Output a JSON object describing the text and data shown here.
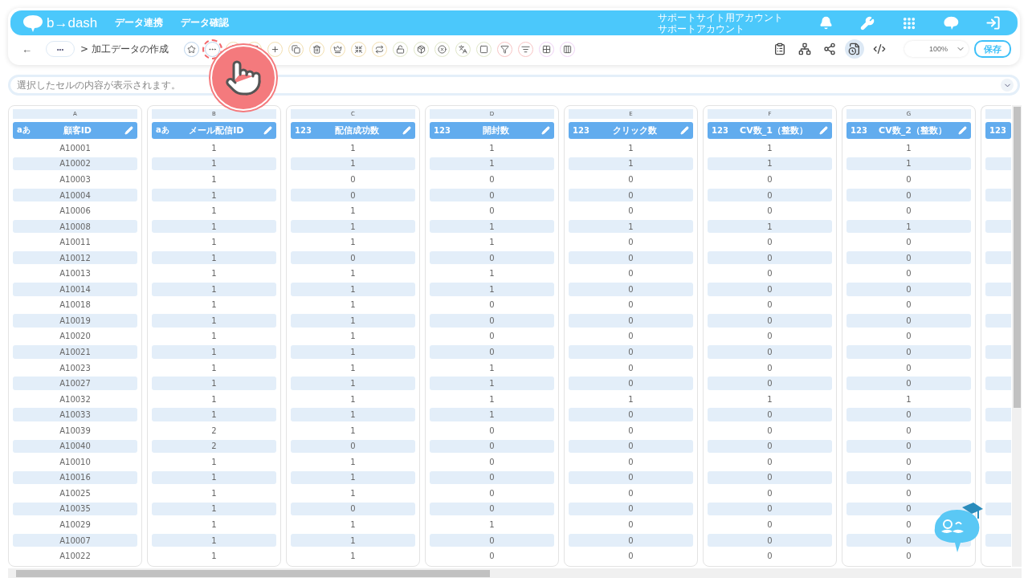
{
  "header": {
    "logo": "b→dash",
    "nav": [
      "データ連携",
      "データ確認"
    ],
    "account": {
      "line_1": "サポートサイト用アカウント",
      "line_2": "サポートアカウント"
    }
  },
  "toolbar": {
    "back": "←",
    "breadcrumb_more": "•••",
    "breadcrumb": "> 加工データの作成",
    "tools": [
      {
        "highlighted": false
      },
      {
        "highlighted": true
      },
      {
        "highlighted": false
      },
      {
        "highlighted": false
      },
      {
        "highlighted": false
      },
      {
        "highlighted": false
      },
      {
        "highlighted": false
      },
      {
        "highlighted": false
      },
      {
        "highlighted": false
      },
      {
        "highlighted": false
      },
      {
        "highlighted": false
      },
      {
        "highlighted": false
      },
      {
        "highlighted": false
      },
      {
        "highlighted": false
      },
      {
        "highlighted": false
      },
      {
        "highlighted": false
      },
      {
        "highlighted": false
      },
      {
        "highlighted": false
      },
      {
        "highlighted": false
      }
    ],
    "view_buttons": [
      {
        "selected": false
      },
      {
        "selected": false
      },
      {
        "selected": false
      },
      {
        "selected": true
      },
      {
        "selected": false
      }
    ],
    "zoom": "100%",
    "save": "保存"
  },
  "formula_bar": {
    "placeholder": "選択したセルの内容が表示されます。"
  },
  "table": {
    "columns": [
      {
        "letter": "A",
        "name": "顧客ID",
        "type": "aあ"
      },
      {
        "letter": "B",
        "name": "メール配信ID",
        "type": "aあ"
      },
      {
        "letter": "C",
        "name": "配信成功数",
        "type": "123"
      },
      {
        "letter": "D",
        "name": "開封数",
        "type": "123"
      },
      {
        "letter": "E",
        "name": "クリック数",
        "type": "123"
      },
      {
        "letter": "F",
        "name": "CV数_1（整数）",
        "type": "123"
      },
      {
        "letter": "G",
        "name": "CV数_2（整数）",
        "type": "123"
      }
    ],
    "partial_column": {
      "type": "123"
    },
    "rows": [
      [
        "A10001",
        "1",
        "1",
        "1",
        "1",
        "1",
        "1"
      ],
      [
        "A10002",
        "1",
        "1",
        "1",
        "1",
        "1",
        "1"
      ],
      [
        "A10003",
        "1",
        "0",
        "0",
        "0",
        "0",
        "0"
      ],
      [
        "A10004",
        "1",
        "0",
        "0",
        "0",
        "0",
        "0"
      ],
      [
        "A10006",
        "1",
        "1",
        "0",
        "0",
        "0",
        "0"
      ],
      [
        "A10008",
        "1",
        "1",
        "1",
        "1",
        "1",
        "1"
      ],
      [
        "A10011",
        "1",
        "1",
        "1",
        "0",
        "0",
        "0"
      ],
      [
        "A10012",
        "1",
        "0",
        "0",
        "0",
        "0",
        "0"
      ],
      [
        "A10013",
        "1",
        "1",
        "1",
        "0",
        "0",
        "0"
      ],
      [
        "A10014",
        "1",
        "1",
        "1",
        "0",
        "0",
        "0"
      ],
      [
        "A10018",
        "1",
        "1",
        "0",
        "0",
        "0",
        "0"
      ],
      [
        "A10019",
        "1",
        "1",
        "0",
        "0",
        "0",
        "0"
      ],
      [
        "A10020",
        "1",
        "1",
        "0",
        "0",
        "0",
        "0"
      ],
      [
        "A10021",
        "1",
        "1",
        "0",
        "0",
        "0",
        "0"
      ],
      [
        "A10023",
        "1",
        "1",
        "1",
        "0",
        "0",
        "0"
      ],
      [
        "A10027",
        "1",
        "1",
        "1",
        "0",
        "0",
        "0"
      ],
      [
        "A10032",
        "1",
        "1",
        "1",
        "1",
        "1",
        "1"
      ],
      [
        "A10033",
        "1",
        "1",
        "1",
        "0",
        "0",
        "0"
      ],
      [
        "A10039",
        "2",
        "1",
        "0",
        "0",
        "0",
        "0"
      ],
      [
        "A10040",
        "2",
        "0",
        "0",
        "0",
        "0",
        "0"
      ],
      [
        "A10010",
        "1",
        "1",
        "0",
        "0",
        "0",
        "0"
      ],
      [
        "A10016",
        "1",
        "1",
        "0",
        "0",
        "0",
        "0"
      ],
      [
        "A10025",
        "1",
        "1",
        "0",
        "0",
        "0",
        "0"
      ],
      [
        "A10035",
        "1",
        "0",
        "0",
        "0",
        "0",
        "0"
      ],
      [
        "A10029",
        "1",
        "1",
        "1",
        "0",
        "0",
        "0"
      ],
      [
        "A10007",
        "1",
        "1",
        "0",
        "0",
        "0",
        "0"
      ],
      [
        "A10022",
        "1",
        "1",
        "0",
        "0",
        "0",
        "0"
      ]
    ]
  }
}
